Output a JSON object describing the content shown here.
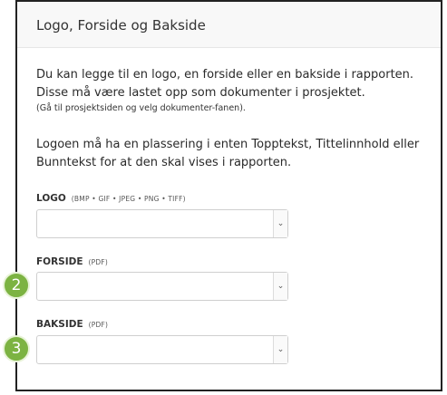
{
  "panel": {
    "title": "Logo, Forside og Bakside",
    "intro": "Du kan legge til en logo, en forside eller en bakside i rapporten. Disse må være lastet opp som dokumenter i prosjektet.",
    "note": "(Gå til prosjektsiden og velg dokumenter-fanen).",
    "logo_info": "Logoen må ha en plassering i enten Topptekst, Tittelinnhold eller Bunntekst for at den skal vises i rapporten."
  },
  "fields": {
    "logo": {
      "label": "LOGO",
      "formats": "(BMP • GIF • JPEG • PNG • TIFF)",
      "value": ""
    },
    "forside": {
      "label": "FORSIDE",
      "formats": "(PDF)",
      "value": ""
    },
    "bakside": {
      "label": "BAKSIDE",
      "formats": "(PDF)",
      "value": ""
    }
  },
  "badges": {
    "forside": "2",
    "bakside": "3"
  },
  "icons": {
    "dropdown": "chevron-down-icon"
  },
  "colors": {
    "badge": "#7cb342"
  }
}
